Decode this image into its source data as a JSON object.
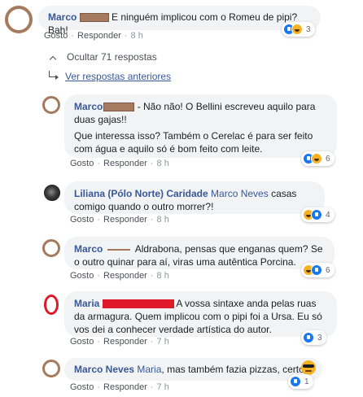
{
  "comments": [
    {
      "name": "Marco",
      "text": " E ninguém implicou com o Romeu de pipi? Bah!",
      "actions": {
        "like": "Gosto",
        "reply": "Responder",
        "time": "8 h"
      },
      "reactions": {
        "count": "3",
        "icons": [
          "like-icon",
          "haha-icon"
        ]
      },
      "avatar": "brown-ring"
    },
    {
      "name": "Marco",
      "text1": "- Não não! O Bellini escreveu aquilo para duas gajas!!",
      "text2": "Que interessa isso? Também o Cerelac é para ser feito com água e aquilo só é bom feito com leite.",
      "actions": {
        "like": "Gosto",
        "reply": "Responder",
        "time": "8 h"
      },
      "reactions": {
        "count": "6",
        "icons": [
          "like-icon",
          "haha-icon"
        ]
      },
      "avatar": "brown-ring"
    },
    {
      "name": "Liliana (Pólo Norte) Caridade",
      "mention": "Marco Neves",
      "text": " casas comigo quando o outro morrer?!",
      "actions": {
        "like": "Gosto",
        "reply": "Responder",
        "time": "8 h"
      },
      "reactions": {
        "count": "4",
        "icons": [
          "haha-icon",
          "like-icon"
        ]
      },
      "avatar": "dark-photo"
    },
    {
      "name": "Marco",
      "text": "Aldrabona, pensas que enganas quem? Se o outro quinar para aí, viras uma autêntica Porcina.",
      "actions": {
        "like": "Gosto",
        "reply": "Responder",
        "time": "8 h"
      },
      "reactions": {
        "count": "6",
        "icons": [
          "haha-icon",
          "like-icon"
        ]
      },
      "avatar": "brown-ring"
    },
    {
      "name": "Maria",
      "text": "A vossa sintaxe anda pelas ruas da armagura. Quem implicou com o pipi foi a Ursa. Eu só vos dei a conhecer verdade artística do autor.",
      "actions": {
        "like": "Gosto",
        "reply": "Responder",
        "time": "7 h"
      },
      "reactions": {
        "count": "3",
        "icons": [
          "like-icon"
        ]
      },
      "avatar": "red-ring"
    },
    {
      "name": "Marco Neves",
      "mention": "Maria",
      "text": ", mas também fazia pizzas, certo?",
      "emoji": "😎",
      "actions": {
        "like": "Gosto",
        "reply": "Responder",
        "time": "7 h"
      },
      "reactions": {
        "count": "1",
        "icons": [
          "like-icon"
        ]
      },
      "avatar": "brown-ring"
    }
  ],
  "thread": {
    "hide_label": "Ocultar 71 respostas",
    "previous_label": "Ver respostas anteriores"
  }
}
